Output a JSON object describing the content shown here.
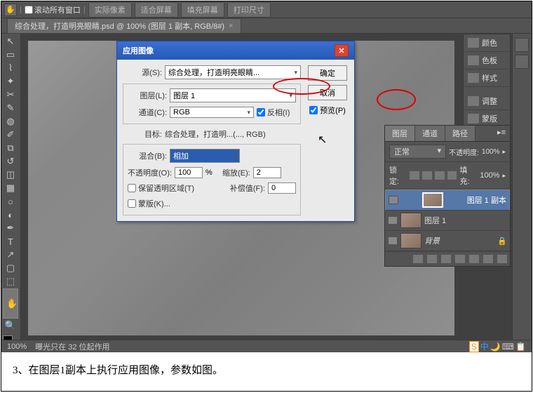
{
  "toolbar": {
    "scroll_all_windows": "滚动所有窗口",
    "actual_pixels": "实际像素",
    "fit_screen": "适合屏幕",
    "fill_screen": "填充屏幕",
    "print_size": "打印尺寸"
  },
  "doc_tab": {
    "title": "综合处理，打造明亮眼睛.psd @ 100% (图层 1 副本, RGB/8#)",
    "close": "×"
  },
  "side_panels": {
    "p0": "颜色",
    "p1": "色板",
    "p2": "样式",
    "p3": "调整",
    "p4": "蒙版",
    "p5": "图层",
    "p6": "通道",
    "p7": "路径"
  },
  "dialog": {
    "title": "应用图像",
    "ok": "确定",
    "cancel": "取消",
    "preview": "预览(P)",
    "source_label": "源(S):",
    "source_value": "综合处理，打造明亮眼睛...",
    "layer_label": "图层(L):",
    "layer_value": "图层 1",
    "channel_label": "通道(C):",
    "channel_value": "RGB",
    "invert": "反相(I)",
    "target_label": "目标:",
    "target_value": "综合处理，打造明...(..., RGB)",
    "blend_label": "混合(B):",
    "blend_value": "相加",
    "opacity_label": "不透明度(O):",
    "opacity_value": "100",
    "opacity_unit": "%",
    "scale_label": "缩放(E):",
    "scale_value": "2",
    "preserve_trans": "保留透明区域(T)",
    "offset_label": "补偿值(F):",
    "offset_value": "0",
    "mask": "蒙版(K)..."
  },
  "layers": {
    "tab_layers": "图层",
    "tab_channels": "通道",
    "tab_paths": "路径",
    "mode": "正常",
    "opacity_label": "不透明度:",
    "opacity_value": "100%",
    "lock_label": "锁定:",
    "fill_label": "填充:",
    "fill_value": "100%",
    "layer0": "图层 1 副本",
    "layer1": "图层 1",
    "layer2": "背景"
  },
  "status": {
    "zoom": "100%",
    "info": "曝光只在 32 位起作用"
  },
  "caption": "3、在图层1副本上执行应用图像，参数如图。"
}
